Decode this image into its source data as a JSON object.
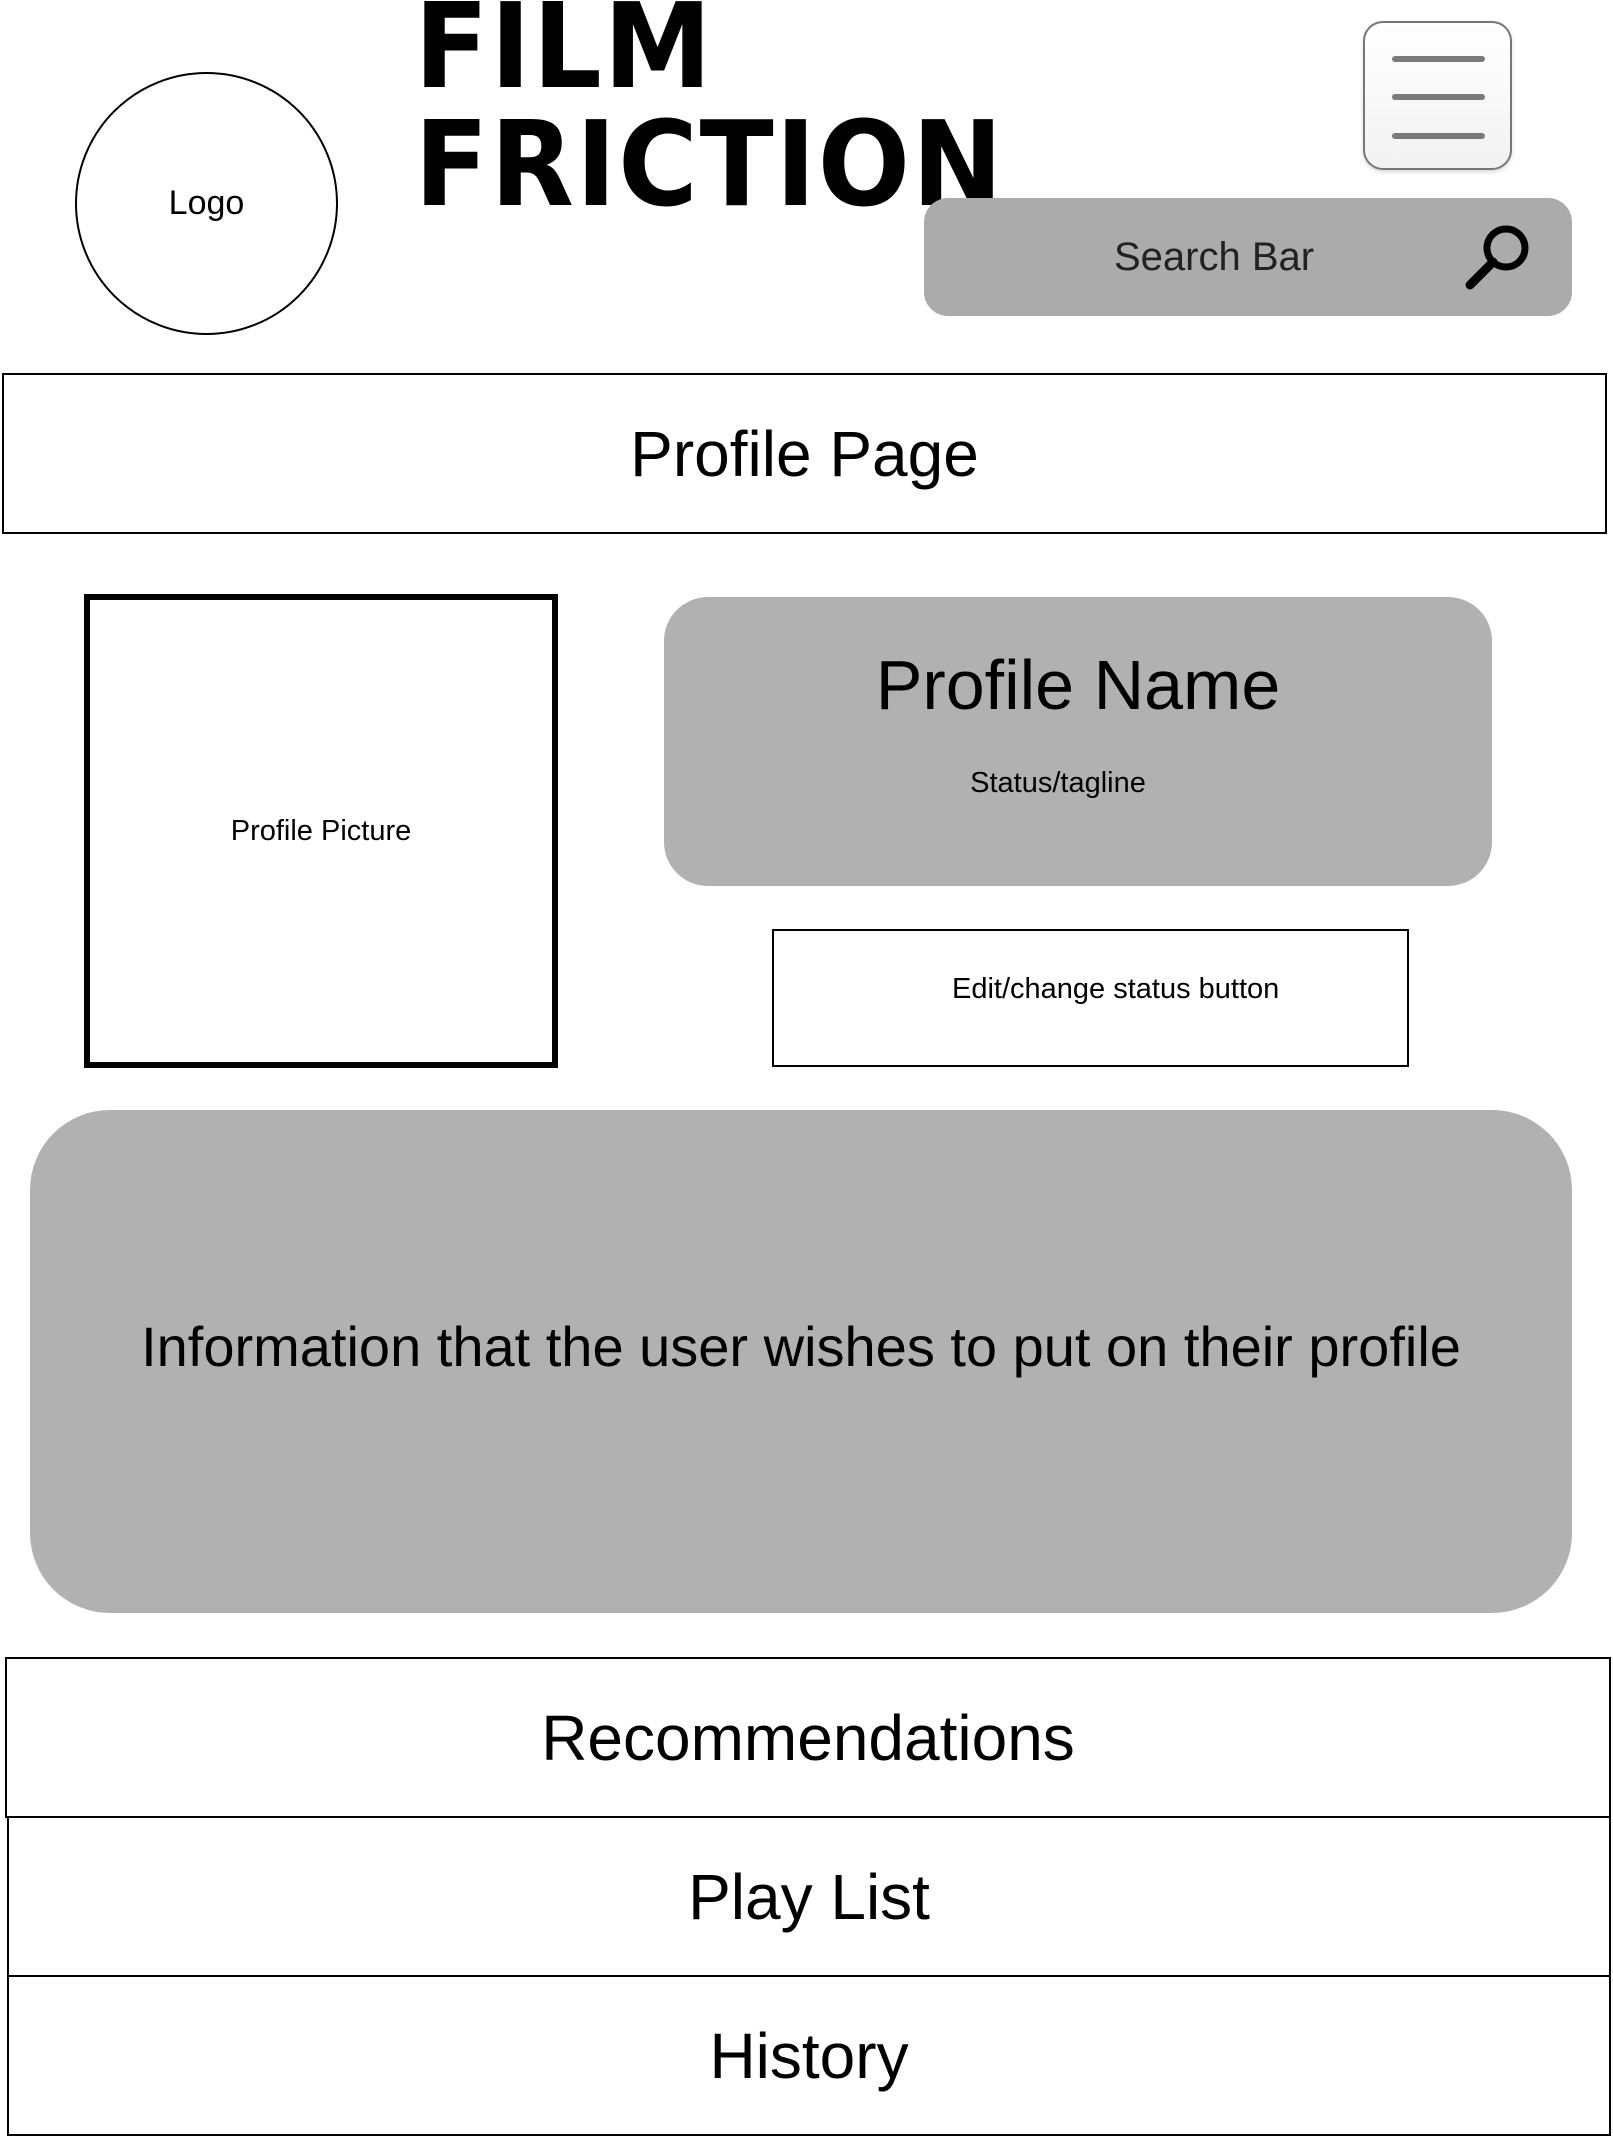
{
  "header": {
    "logo_text": "Logo",
    "brand_title": "FILM FRICTION",
    "menu_icon": "hamburger-menu-icon",
    "search_placeholder": "Search Bar",
    "search_icon": "magnifying-glass-icon"
  },
  "page_title": "Profile Page",
  "profile": {
    "picture_label": "Profile Picture",
    "name": "Profile Name",
    "tagline": "Status/tagline",
    "edit_status_label": "Edit/change status button",
    "info_text": "Information that the user wishes to put on their profile"
  },
  "sections": {
    "recommendations": "Recommendations",
    "playlist": "Play List",
    "history": "History"
  },
  "colors": {
    "search_bg": "#ababab",
    "card_bg": "#b1b1b1",
    "menu_line": "#7a7a7a"
  }
}
